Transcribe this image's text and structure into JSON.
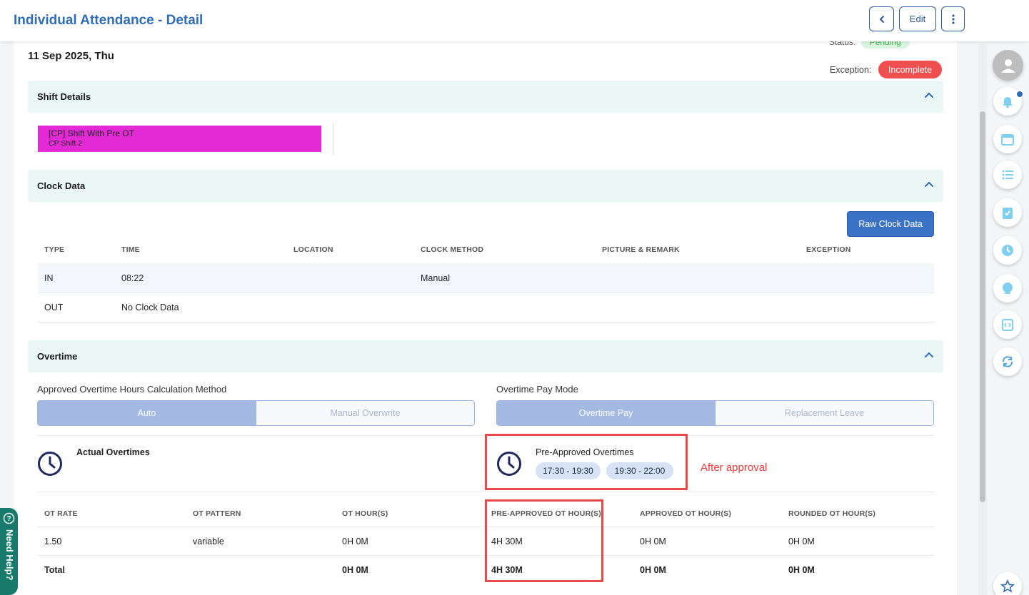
{
  "header": {
    "title": "Individual Attendance - Detail",
    "back_label": "‹",
    "edit_label": "Edit",
    "more_label": "⋮"
  },
  "record": {
    "date": "11 Sep 2025, Thu",
    "status_label": "Status:",
    "status_value": "Pending",
    "exception_label": "Exception:",
    "exception_value": "Incomplete"
  },
  "shift_section": {
    "title": "Shift Details",
    "shift_name": "[CP] Shift With Pre OT",
    "shift_code": "CP Shift 2",
    "shift_color": "#e42ad6"
  },
  "clock_section": {
    "title": "Clock Data",
    "raw_button": "Raw Clock Data",
    "columns": [
      "TYPE",
      "TIME",
      "LOCATION",
      "CLOCK METHOD",
      "PICTURE & REMARK",
      "EXCEPTION"
    ],
    "rows": [
      {
        "type": "IN",
        "time": "08:22",
        "location": "",
        "method": "Manual",
        "remark": "",
        "exception": ""
      },
      {
        "type": "OUT",
        "time": "No Clock Data",
        "location": "",
        "method": "",
        "remark": "",
        "exception": ""
      }
    ]
  },
  "overtime_section": {
    "title": "Overtime",
    "calc_label": "Approved Overtime Hours Calculation Method",
    "calc_options": [
      "Auto",
      "Manual Overwrite"
    ],
    "calc_selected": "Auto",
    "pay_label": "Overtime Pay Mode",
    "pay_options": [
      "Overtime Pay",
      "Replacement Leave"
    ],
    "pay_selected": "Overtime Pay",
    "actual_title": "Actual Overtimes",
    "preapproved_title": "Pre-Approved Overtimes",
    "preapproved_chips": [
      "17:30 - 19:30",
      "19:30 - 22:00"
    ],
    "annotation": "After approval",
    "columns": [
      "OT RATE",
      "OT PATTERN",
      "OT HOUR(S)",
      "PRE-APPROVED OT HOUR(S)",
      "APPROVED OT HOUR(S)",
      "ROUNDED OT HOUR(S)"
    ],
    "rows": [
      {
        "rate": "1.50",
        "pattern": "variable",
        "ot": "0H 0M",
        "pre": "4H 30M",
        "approved": "0H 0M",
        "rounded": "0H 0M"
      }
    ],
    "total": {
      "label": "Total",
      "ot": "0H 0M",
      "pre": "4H 30M",
      "approved": "0H 0M",
      "rounded": "0H 0M"
    }
  },
  "help": {
    "label": "Need Help?"
  },
  "colors": {
    "brand": "#2f6db5",
    "accent_button": "#3a73c5",
    "exception": "#f04f4f",
    "annotation": "#e64a4a",
    "section_bg": "#eaf7f5"
  },
  "rail_icons": [
    "user-avatar-icon",
    "bell-icon",
    "calendar-icon",
    "list-icon",
    "clipboard-check-icon",
    "clock-icon",
    "globe-icon",
    "code-icon",
    "refresh-icon",
    "star-icon"
  ]
}
